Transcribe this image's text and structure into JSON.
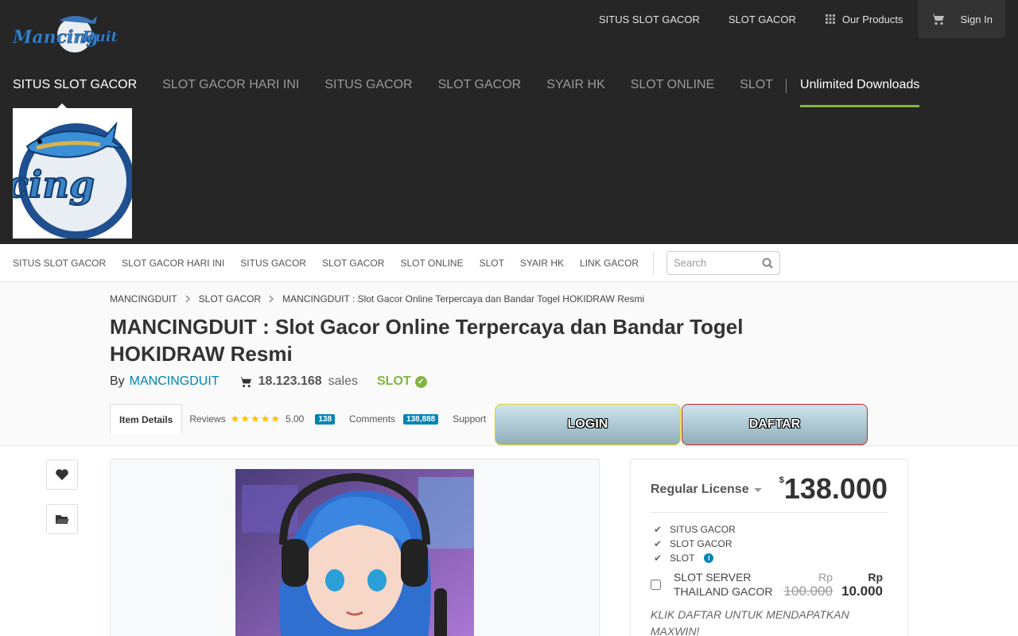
{
  "header": {
    "top_links": [
      "SITUS SLOT GACOR",
      "SLOT GACOR",
      "Our Products",
      "Sign In"
    ],
    "main_nav": [
      "SITUS SLOT GACOR",
      "SLOT GACOR HARI INI",
      "SITUS GACOR",
      "SLOT GACOR",
      "SYAIR HK",
      "SLOT ONLINE",
      "SLOT"
    ],
    "unlimited": "Unlimited Downloads",
    "logo_text": "Mancing Duit"
  },
  "subnav": {
    "items": [
      "SITUS SLOT GACOR",
      "SLOT GACOR HARI INI",
      "SITUS GACOR",
      "SLOT GACOR",
      "SLOT ONLINE",
      "SLOT",
      "SYAIR HK",
      "LINK GACOR"
    ],
    "search_placeholder": "Search"
  },
  "breadcrumb": [
    "MANCINGDUIT",
    "SLOT GACOR",
    "MANCINGDUIT : Slot Gacor Online Terpercaya dan Bandar Togel HOKIDRAW Resmi"
  ],
  "item": {
    "title": "MANCINGDUIT : Slot Gacor Online Terpercaya dan Bandar Togel HOKIDRAW Resmi",
    "by": "By",
    "author": "MANCINGDUIT",
    "sales_count": "18.123.168",
    "sales_label": "sales",
    "tag": "SLOT"
  },
  "tabs": {
    "item_details": "Item Details",
    "reviews": "Reviews",
    "rating": "5.00",
    "reviews_count": "138",
    "comments": "Comments",
    "comments_count": "138,888",
    "support": "Support"
  },
  "buttons": {
    "login": "LOGIN",
    "daftar": "DAFTAR"
  },
  "license": {
    "name": "Regular License",
    "currency": "$",
    "price": "138.000",
    "features": [
      "SITUS GACOR",
      "SLOT GACOR",
      "SLOT"
    ],
    "addon_label": "SLOT SERVER THAILAND GACOR",
    "addon_currency": "Rp",
    "addon_old_price": "100.000",
    "addon_new_price": "10.000",
    "promo": "KLIK DAFTAR UNTUK MENDAPATKAN MAXWIN!"
  },
  "colors": {
    "header_bg": "#262626",
    "accent_green": "#82b541",
    "link_blue": "#0084b4"
  },
  "icons": [
    "grid-icon",
    "cart-icon",
    "heart-icon",
    "folder-icon",
    "search-icon",
    "check-icon",
    "chevron-right-icon",
    "star-icon",
    "info-icon"
  ]
}
